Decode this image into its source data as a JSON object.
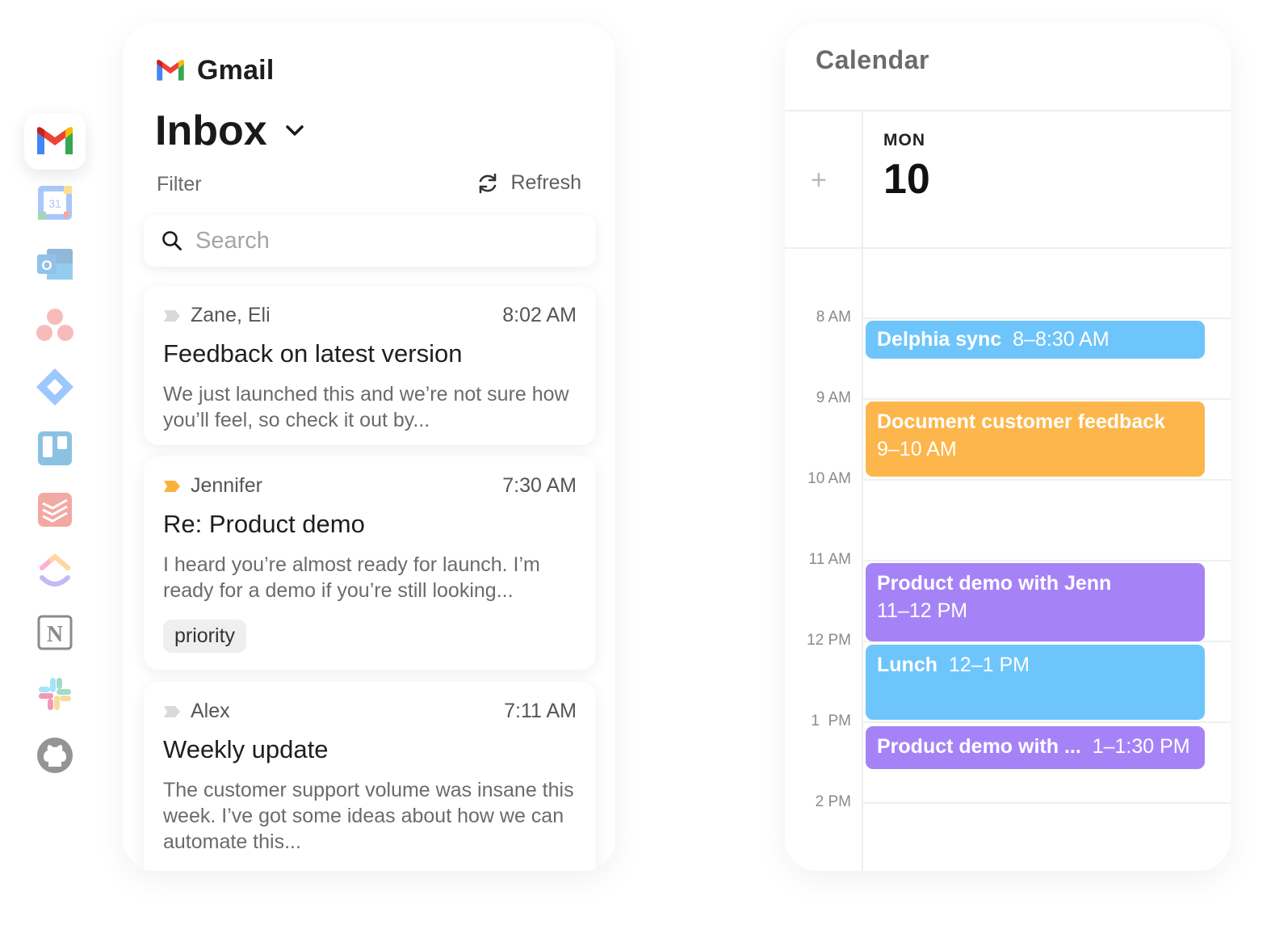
{
  "rail": {
    "apps": [
      {
        "name": "gmail",
        "icon": "gmail-icon"
      },
      {
        "name": "google-calendar",
        "icon": "google-calendar-icon",
        "label": "31"
      },
      {
        "name": "outlook",
        "icon": "outlook-icon",
        "label": "O"
      },
      {
        "name": "asana",
        "icon": "asana-icon"
      },
      {
        "name": "jira",
        "icon": "jira-icon"
      },
      {
        "name": "trello",
        "icon": "trello-icon"
      },
      {
        "name": "todoist",
        "icon": "todoist-icon"
      },
      {
        "name": "clickup",
        "icon": "clickup-icon"
      },
      {
        "name": "notion",
        "icon": "notion-icon",
        "label": "N"
      },
      {
        "name": "slack",
        "icon": "slack-icon"
      },
      {
        "name": "github",
        "icon": "github-icon"
      }
    ]
  },
  "gmail": {
    "brand": "Gmail",
    "folder": "Inbox",
    "filter_label": "Filter",
    "refresh_label": "Refresh",
    "search_placeholder": "Search",
    "emails": [
      {
        "sender": "Zane, Eli",
        "time": "8:02 AM",
        "subject": "Feedback on latest version",
        "preview": "We just launched this and we’re not sure how you’ll feel, so check it out by...",
        "important": false
      },
      {
        "sender": "Jennifer",
        "time": "7:30 AM",
        "subject": "Re: Product demo",
        "preview": "I heard you’re almost ready for launch. I’m ready for a demo if you’re still looking...",
        "important": true,
        "label": "priority"
      },
      {
        "sender": "Alex",
        "time": "7:11 AM",
        "subject": "Weekly update",
        "preview": "The customer support volume was insane this week. I’ve got some ideas about how we can automate this...",
        "important": false
      }
    ]
  },
  "calendar": {
    "title": "Calendar",
    "add_label": "+",
    "day_of_week": "MON",
    "day_number": "10",
    "hours": [
      "8 AM",
      "9 AM",
      "10 AM",
      "11 AM",
      "12 PM",
      "1  PM",
      "2 PM"
    ],
    "events": [
      {
        "title": "Delphia sync",
        "time": "8–8:30 AM",
        "color": "#6ec5fb"
      },
      {
        "title": "Document customer feedback",
        "time": "9–10 AM",
        "color": "#fdb64b"
      },
      {
        "title": "Product demo with Jenn",
        "time": "11–12 PM",
        "color": "#a583f7"
      },
      {
        "title": "Lunch",
        "time": "12–1 PM",
        "color": "#6ec5fb"
      },
      {
        "title": "Product demo with ...",
        "time": "1–1:30 PM",
        "color": "#a583f7"
      }
    ]
  },
  "colors": {
    "important_marker": "#fbb03b",
    "unimportant_marker": "#d9d9d9"
  }
}
